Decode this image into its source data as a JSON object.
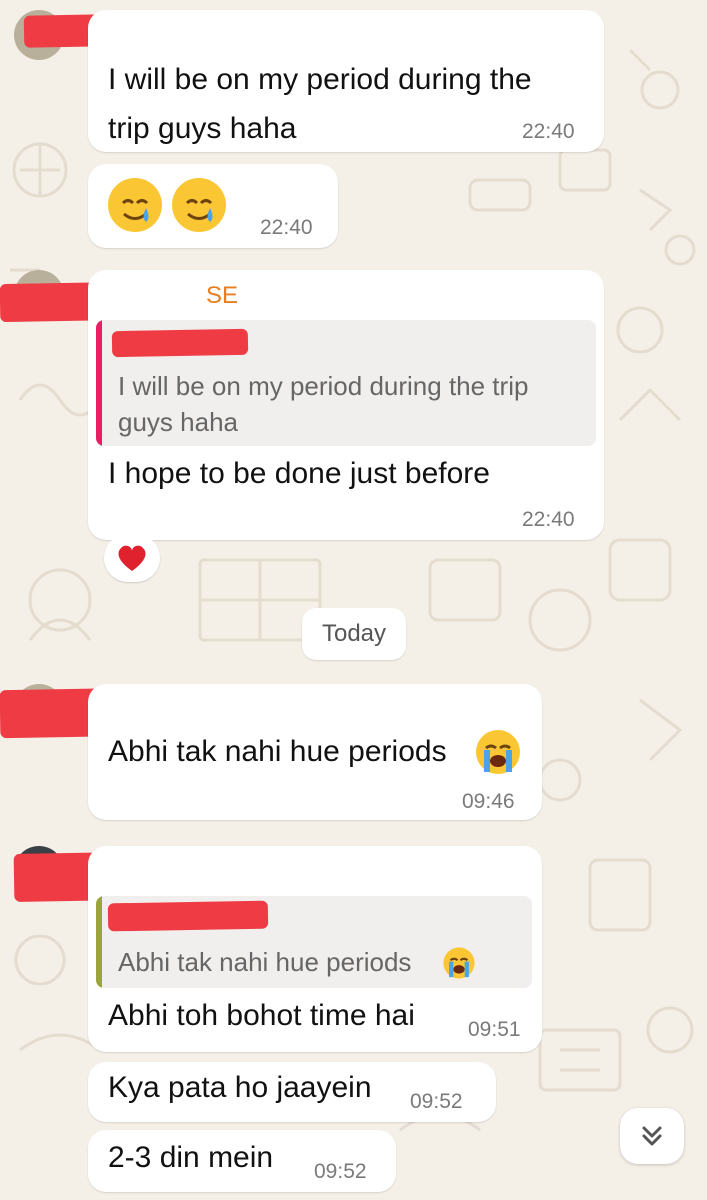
{
  "chat": {
    "messages": [
      {
        "id": 1,
        "text_line1": "I will be on my period during the",
        "text_line2": "trip guys haha",
        "time": "22:40"
      },
      {
        "id": 2,
        "emoji_names": [
          "smiling-face-with-tear-icon",
          "smiling-face-with-tear-icon"
        ],
        "time": "22:40"
      },
      {
        "id": 3,
        "name_fragment": "SE",
        "quote_line1": "I will be on my period during the trip",
        "quote_line2": "guys haha",
        "text": "I hope to be done just before",
        "time": "22:40",
        "reaction": "red-heart-icon"
      },
      {
        "id": 4,
        "text": "Abhi tak nahi hue periods",
        "emoji": "loudly-crying-face-icon",
        "time": "09:46"
      },
      {
        "id": 5,
        "quote": "Abhi tak nahi hue periods",
        "quote_emoji": "loudly-crying-face-icon",
        "text": "Abhi toh bohot time hai",
        "time": "09:51"
      },
      {
        "id": 6,
        "text": "Kya pata ho jaayein",
        "time": "09:52"
      },
      {
        "id": 7,
        "text": "2-3 din mein",
        "time": "09:52"
      }
    ],
    "date_divider": "Today"
  },
  "colors": {
    "background": "#f4efe7",
    "bubble": "#ffffff",
    "redaction": "#ef3b44",
    "quote_bar_pink": "#e91e63",
    "quote_bar_olive": "#9aa637",
    "timestamp": "#7a7a7a"
  },
  "scroll_button_icon": "double-chevron-down-icon"
}
